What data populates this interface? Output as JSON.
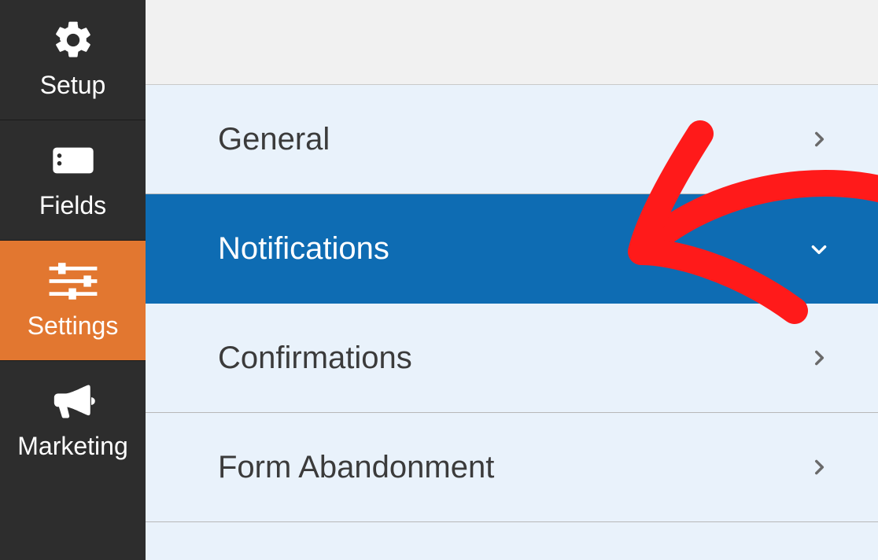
{
  "sidebar": {
    "items": [
      {
        "label": "Setup"
      },
      {
        "label": "Fields"
      },
      {
        "label": "Settings"
      },
      {
        "label": "Marketing"
      }
    ]
  },
  "settings_panel": {
    "items": [
      {
        "label": "General"
      },
      {
        "label": "Notifications"
      },
      {
        "label": "Confirmations"
      },
      {
        "label": "Form Abandonment"
      }
    ]
  }
}
